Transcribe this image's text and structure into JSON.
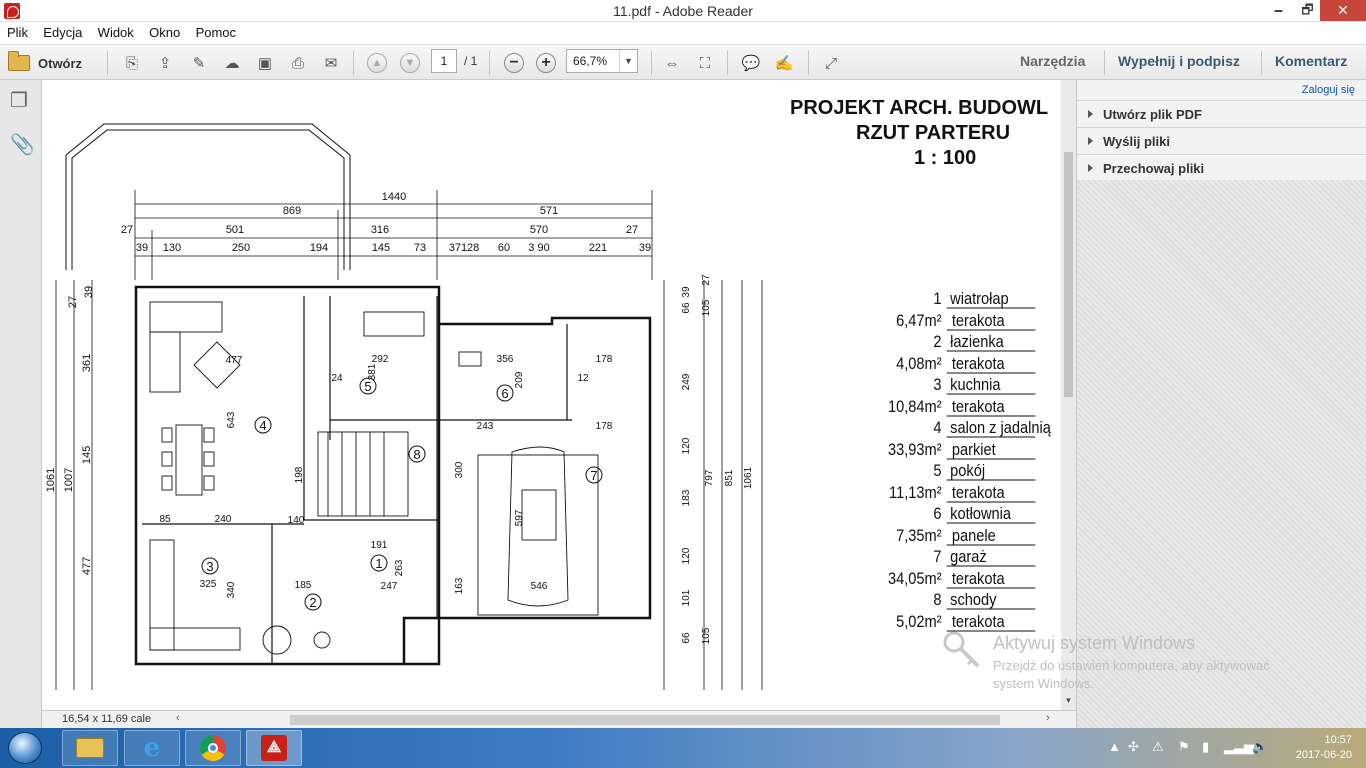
{
  "window": {
    "title": "11.pdf - Adobe Reader",
    "minimize": "🗕",
    "maximize": "🗗",
    "close": "✕"
  },
  "menu": [
    "Plik",
    "Edycja",
    "Widok",
    "Okno",
    "Pomoc"
  ],
  "toolbar": {
    "open_label": "Otwórz",
    "page_current": "1",
    "page_total": "/ 1",
    "zoom": "66,7%",
    "tools_label": "Narzędzia",
    "fill_sign_label": "Wypełnij i podpisz",
    "comment_label": "Komentarz"
  },
  "right_panel": {
    "login": "Zaloguj się",
    "items": [
      "Utwórz plik PDF",
      "Wyślij pliki",
      "Przechowaj pliki"
    ]
  },
  "document": {
    "heading": [
      "PROJEKT ARCH. BUDOWL",
      "RZUT    PARTERU",
      "1 : 100"
    ],
    "dims_top": {
      "total": "1440",
      "row2": [
        "869",
        "571"
      ],
      "row3": [
        "27",
        "501",
        "316",
        "570",
        "27"
      ],
      "row4": [
        "39",
        "130",
        "250",
        "194",
        "145",
        "73",
        "37128",
        "60",
        "3 90",
        "221",
        "39"
      ]
    },
    "dims_left": [
      "1061",
      "1007",
      "361",
      "145",
      "477",
      "27",
      "39"
    ],
    "dims_right": [
      "27",
      "39",
      "66",
      "105",
      "249",
      "120",
      "183",
      "120",
      "101",
      "66",
      "105",
      "797",
      "851",
      "1061"
    ],
    "rooms": [
      {
        "no": "1",
        "name": "wiatrołap",
        "area": "6,47m²",
        "finish": "terakota"
      },
      {
        "no": "2",
        "name": "łazienka",
        "area": "4,08m²",
        "finish": "terakota"
      },
      {
        "no": "3",
        "name": "kuchnia",
        "area": "10,84m²",
        "finish": "terakota"
      },
      {
        "no": "4",
        "name": "salon z jadalnią",
        "area": "33,93m²",
        "finish": "parkiet"
      },
      {
        "no": "5",
        "name": "pokój",
        "area": "11,13m²",
        "finish": "terakota"
      },
      {
        "no": "6",
        "name": "kotłownia",
        "area": "7,35m²",
        "finish": "panele"
      },
      {
        "no": "7",
        "name": "garaż",
        "area": "34,05m²",
        "finish": "terakota"
      },
      {
        "no": "8",
        "name": "schody",
        "area": "5,02m²",
        "finish": "terakota"
      }
    ],
    "plan_labels": [
      "477",
      "643",
      "292",
      "381",
      "356",
      "209",
      "178",
      "243",
      "178",
      "300",
      "198",
      "240",
      "325",
      "340",
      "185",
      "247",
      "263",
      "191",
      "546",
      "597",
      "85",
      "24",
      "12",
      "140",
      "163"
    ]
  },
  "status": {
    "page_size": "16,54 x 11,69 cale"
  },
  "activation": {
    "title": "Aktywuj system Windows",
    "line1": "Przejdź do ustawień komputera, aby aktywować",
    "line2": "system Windows."
  },
  "clock": {
    "time": "10:57",
    "date": "2017-06-20"
  }
}
